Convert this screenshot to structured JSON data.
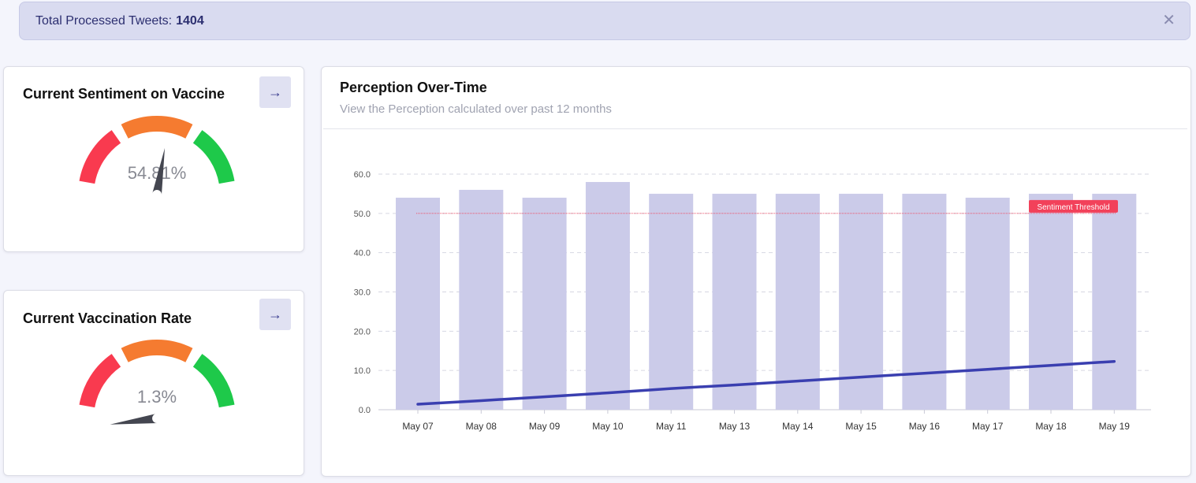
{
  "banner": {
    "label": "Total Processed Tweets:",
    "count": "1404",
    "close_glyph": "✕"
  },
  "sentiment_card": {
    "title": "Current Sentiment on Vaccine",
    "value_text": "54.81%",
    "value": 54.81,
    "arrow_glyph": "→"
  },
  "vaccination_card": {
    "title": "Current Vaccination Rate",
    "value_text": "1.3%",
    "value": 1.3,
    "arrow_glyph": "→"
  },
  "gauge_colors": {
    "low": "#f93a4f",
    "mid": "#f57b30",
    "high": "#1ec94a",
    "needle": "#444650"
  },
  "perception": {
    "title": "Perception Over-Time",
    "subtitle": "View the Perception calculated over past 12 months"
  },
  "chart_data": {
    "type": "bar",
    "categories": [
      "May 07",
      "May 08",
      "May 09",
      "May 10",
      "May 11",
      "May 13",
      "May 14",
      "May 15",
      "May 16",
      "May 17",
      "May 18",
      "May 19"
    ],
    "series": [
      {
        "type": "bar",
        "values": [
          54,
          56,
          54,
          58,
          55,
          55,
          55,
          55,
          55,
          54,
          55,
          55
        ],
        "color": "#cbcbe9"
      },
      {
        "type": "line",
        "values": [
          1.4,
          2.3,
          3.3,
          4.3,
          5.4,
          6.3,
          7.3,
          8.3,
          9.3,
          10.3,
          11.3,
          12.3
        ],
        "color": "#3a3fb0"
      }
    ],
    "ylim": [
      0,
      60
    ],
    "yticks": [
      "0.0",
      "10.0",
      "20.0",
      "30.0",
      "40.0",
      "50.0",
      "60.0"
    ],
    "threshold": {
      "value": 50,
      "label": "Sentiment Threshold",
      "color": "#f2415a"
    },
    "grid": true
  }
}
